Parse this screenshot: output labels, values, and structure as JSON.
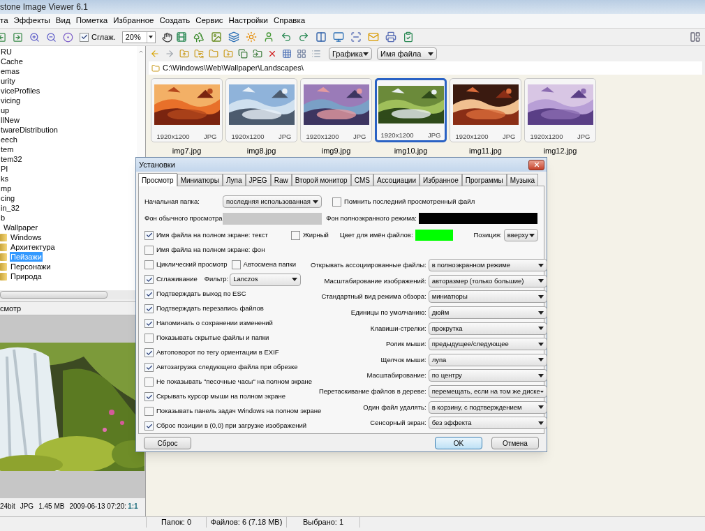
{
  "window": {
    "title": "stone Image Viewer 6.1"
  },
  "menu": [
    "та",
    "Эффекты",
    "Вид",
    "Пометка",
    "Избранное",
    "Создать",
    "Сервис",
    "Настройки",
    "Справка"
  ],
  "toolbar": {
    "smooth": {
      "label": "Сглаж.",
      "checked": true
    },
    "zoom": "20%"
  },
  "tree": [
    {
      "label": "RU",
      "selected": false
    },
    {
      "label": "Cache",
      "selected": false
    },
    {
      "label": "emas",
      "selected": false
    },
    {
      "label": "urity",
      "selected": false
    },
    {
      "label": "viceProfiles",
      "selected": false
    },
    {
      "label": "vicing",
      "selected": false
    },
    {
      "label": "up",
      "selected": false
    },
    {
      "label": "llNew",
      "selected": false
    },
    {
      "label": "twareDistribution",
      "selected": false
    },
    {
      "label": "eech",
      "selected": false
    },
    {
      "label": "tem",
      "selected": false
    },
    {
      "label": "tem32",
      "selected": false
    },
    {
      "label": "PI",
      "selected": false
    },
    {
      "label": "ks",
      "selected": false
    },
    {
      "label": "mp",
      "selected": false
    },
    {
      "label": "cing",
      "selected": false
    },
    {
      "label": "in_32",
      "selected": false
    },
    {
      "label": "b",
      "selected": false,
      "children": [
        {
          "label": "Wallpaper",
          "selected": false,
          "children": [
            {
              "label": "Windows",
              "selected": false
            },
            {
              "label": "Архитектура",
              "selected": false
            },
            {
              "label": "Пейзажи",
              "selected": true
            },
            {
              "label": "Персонажи",
              "selected": false
            },
            {
              "label": "Природа",
              "selected": false
            }
          ]
        }
      ]
    }
  ],
  "preview": {
    "title": "смотр",
    "info": {
      "bits": "24bit",
      "type": "JPG",
      "size": "1.45 MB",
      "date": "2009-06-13 07:20:",
      "zoom": "1:1"
    }
  },
  "nav": {
    "filter": "Графика",
    "sort": "Имя файла",
    "path": "C:\\Windows\\Web\\Wallpaper\\Landscapes\\"
  },
  "thumbnails": [
    {
      "name": "img7.jpg",
      "size": "1920x1200",
      "type": "JPG",
      "selected": false
    },
    {
      "name": "img8.jpg",
      "size": "1920x1200",
      "type": "JPG",
      "selected": false
    },
    {
      "name": "img9.jpg",
      "size": "1920x1200",
      "type": "JPG",
      "selected": false
    },
    {
      "name": "img10.jpg",
      "size": "1920x1200",
      "type": "JPG",
      "selected": true
    },
    {
      "name": "img11.jpg",
      "size": "1920x1200",
      "type": "JPG",
      "selected": false
    },
    {
      "name": "img12.jpg",
      "size": "1920x1200",
      "type": "JPG",
      "selected": false
    }
  ],
  "dialog": {
    "title": "Установки",
    "tabs": [
      {
        "label": "Просмотр",
        "selected": true
      },
      {
        "label": "Миниатюры",
        "selected": false
      },
      {
        "label": "Лупа",
        "selected": false
      },
      {
        "label": "JPEG",
        "selected": false
      },
      {
        "label": "Raw",
        "selected": false
      },
      {
        "label": "Второй монитор",
        "selected": false
      },
      {
        "label": "CMS",
        "selected": false
      },
      {
        "label": "Ассоциации",
        "selected": false
      },
      {
        "label": "Избранное",
        "selected": false
      },
      {
        "label": "Программы",
        "selected": false
      },
      {
        "label": "Музыка",
        "selected": false
      }
    ],
    "start_folder": {
      "label": "Начальная папка:",
      "value": "последняя использованная"
    },
    "remember": {
      "label": "Помнить последний просмотренный файл",
      "checked": false
    },
    "normal_bg": {
      "label": "Фон обычного просмотра:",
      "color": "#c8c8c8"
    },
    "fullscreen_bg": {
      "label": "Фон полноэкранного режима:",
      "color": "#000000"
    },
    "filename_text": {
      "label": "Имя файла на полном экране: текст",
      "checked": true
    },
    "bold": {
      "label": "Жирный",
      "checked": false
    },
    "name_color": {
      "label": "Цвет для имён файлов:",
      "color": "#00ff00"
    },
    "position": {
      "label": "Позиция:",
      "value": "вверху"
    },
    "left_rows": [
      {
        "items": [
          {
            "kind": "checkbox",
            "label": "Имя файла на полном экране: фон",
            "checked": false
          }
        ]
      },
      {
        "items": [
          {
            "kind": "checkbox",
            "label": "Циклический просмотр",
            "checked": false
          },
          {
            "kind": "checkbox",
            "label": "Автосмена папки",
            "checked": false
          }
        ]
      },
      {
        "items": [
          {
            "kind": "checkbox",
            "label": "Сглаживание",
            "checked": true
          },
          {
            "kind": "select",
            "label": "Фильтр:",
            "value": "Lanczos"
          }
        ]
      },
      {
        "items": [
          {
            "kind": "checkbox",
            "label": "Подтверждать выход по ESC",
            "checked": true
          }
        ]
      },
      {
        "items": [
          {
            "kind": "checkbox",
            "label": "Подтверждать перезапись файлов",
            "checked": true
          }
        ]
      },
      {
        "items": [
          {
            "kind": "checkbox",
            "label": "Напоминать о сохранении изменений",
            "checked": true
          }
        ]
      },
      {
        "items": [
          {
            "kind": "checkbox",
            "label": "Показывать скрытые файлы и папки",
            "checked": false
          }
        ]
      },
      {
        "items": [
          {
            "kind": "checkbox",
            "label": "Автоповорот по тегу ориентации в EXIF",
            "checked": true
          }
        ]
      },
      {
        "items": [
          {
            "kind": "checkbox",
            "label": "Автозагрузка следующего файла при обрезке",
            "checked": true
          }
        ]
      },
      {
        "items": [
          {
            "kind": "checkbox",
            "label": "Не показывать \"песочные часы\" на полном экране",
            "checked": false
          }
        ]
      },
      {
        "items": [
          {
            "kind": "checkbox",
            "label": "Скрывать курсор мыши на полном экране",
            "checked": true
          }
        ]
      },
      {
        "items": [
          {
            "kind": "checkbox",
            "label": "Показывать панель задач Windows на полном экране",
            "checked": false
          }
        ]
      },
      {
        "items": [
          {
            "kind": "checkbox",
            "label": "Сброс позиции в (0,0) при загрузке изображений",
            "checked": true
          }
        ]
      }
    ],
    "right_selects": [
      {
        "label": "Открывать ассоциированные файлы:",
        "value": "в полноэкранном режиме"
      },
      {
        "label": "Масштабирование изображений:",
        "value": "авторазмер (только большие)"
      },
      {
        "label": "Стандартный вид режима обзора:",
        "value": "миниатюры"
      },
      {
        "label": "Единицы по умолчанию:",
        "value": "дюйм"
      },
      {
        "label": "Клавиши-стрелки:",
        "value": "прокрутка"
      },
      {
        "label": "Ролик мыши:",
        "value": "предыдущее/следующее"
      },
      {
        "label": "Щелчок мыши:",
        "value": "лупа"
      },
      {
        "label": "Масштабирование:",
        "value": "по центру"
      },
      {
        "label": "Перетаскивание файлов в дереве:",
        "value": "перемещать, если на том же диске"
      },
      {
        "label": "Один файл удалять:",
        "value": "в корзину, с подтверждением"
      },
      {
        "label": "Сенсорный экран:",
        "value": "без эффекта"
      }
    ],
    "buttons": {
      "reset": "Сброс",
      "ok": "OK",
      "cancel": "Отмена"
    }
  },
  "status_bar": [
    "Папок: 0",
    "Файлов: 6 (7.18 MB)",
    "Выбрано: 1"
  ]
}
